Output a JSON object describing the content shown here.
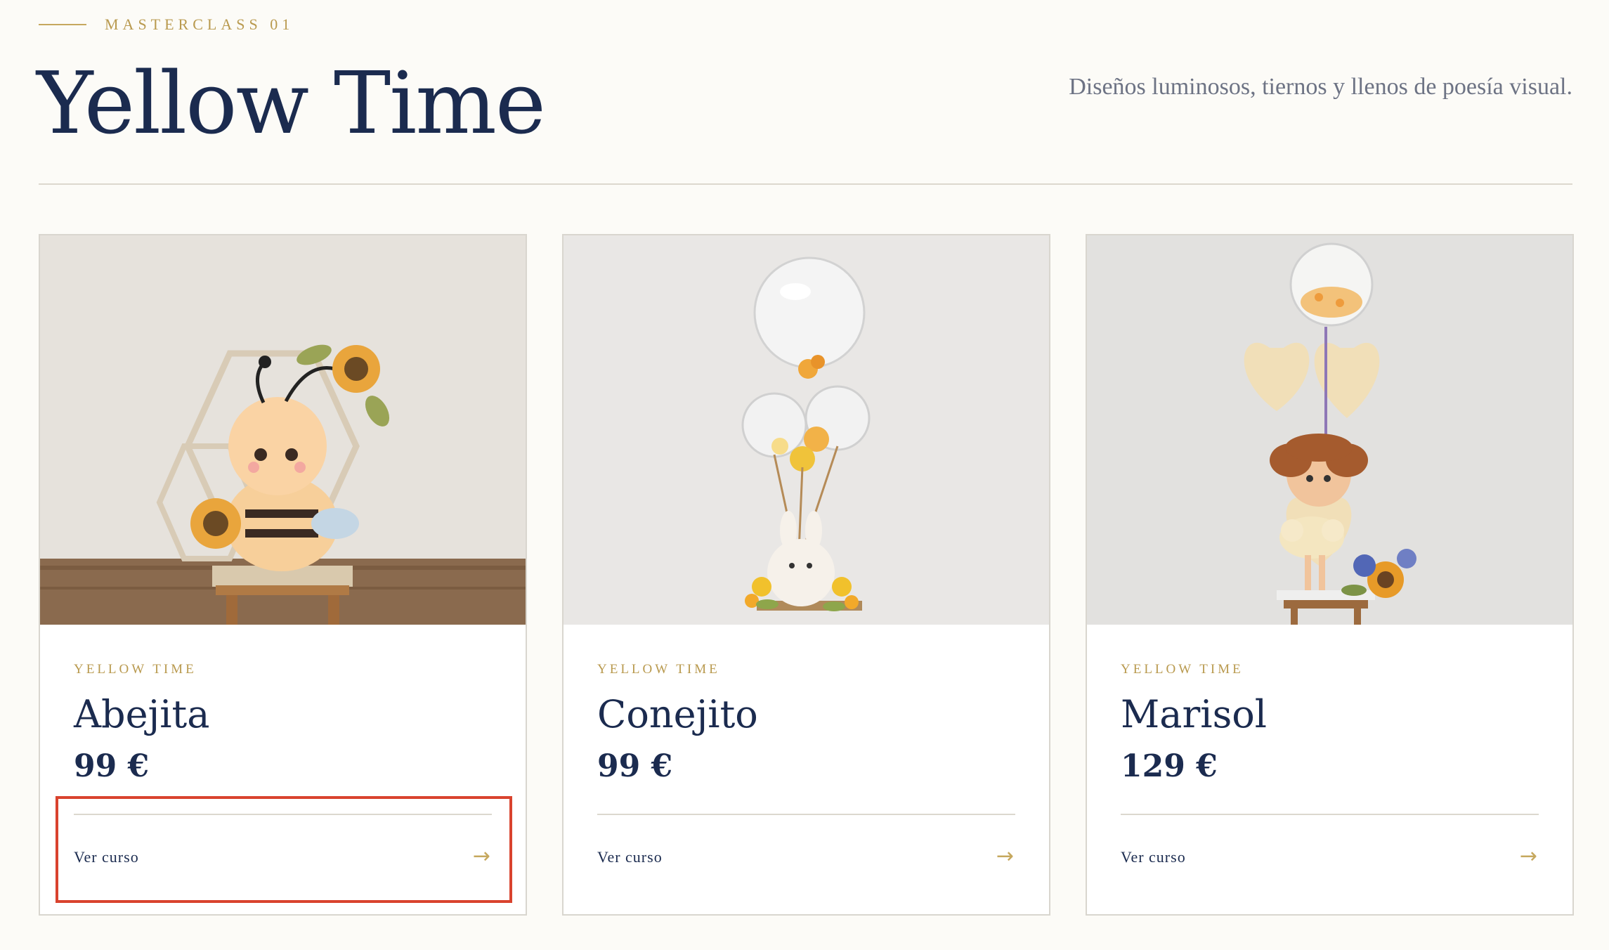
{
  "header": {
    "eyebrow": "MASTERCLASS 01",
    "title": "Yellow Time",
    "subtitle": "Diseños luminosos, tiernos y llenos de poesía visual."
  },
  "colors": {
    "accent": "#c6a85e",
    "navy": "#1b2b4f",
    "highlight": "#d9432e"
  },
  "cards": [
    {
      "category": "YELLOW TIME",
      "title": "Abejita",
      "price": "99 €",
      "link": "Ver curso",
      "arrow": "→",
      "image": "bee-balloon-figure"
    },
    {
      "category": "YELLOW TIME",
      "title": "Conejito",
      "price": "99 €",
      "link": "Ver curso",
      "arrow": "→",
      "image": "bunny-balloon-bouquet"
    },
    {
      "category": "YELLOW TIME",
      "title": "Marisol",
      "price": "129 €",
      "link": "Ver curso",
      "arrow": "→",
      "image": "girl-hearts-balloon-figure"
    }
  ]
}
